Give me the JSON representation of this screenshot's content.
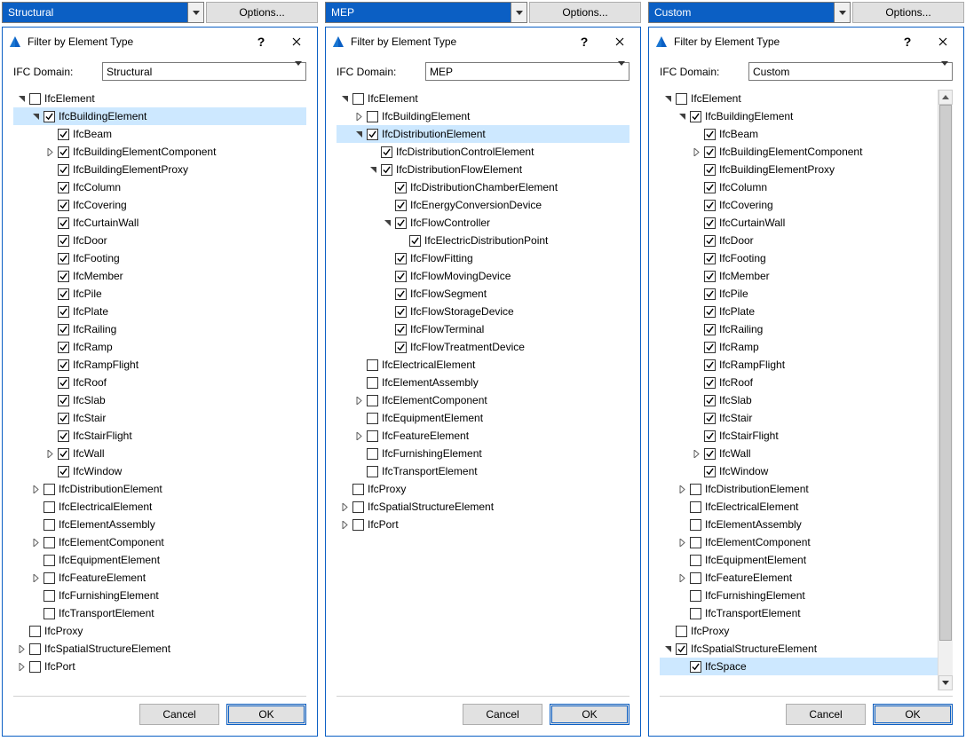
{
  "ribbon_options_label": "Options...",
  "dialog_title": "Filter by Element Type",
  "ifc_domain_label": "IFC Domain:",
  "cancel_label": "Cancel",
  "ok_label": "OK",
  "panels": [
    {
      "ribbon_value": "Structural",
      "domain_select_value": "Structural",
      "has_scrollbar": false,
      "tree": [
        {
          "d": 0,
          "e": "open",
          "c": false,
          "t": "IfcElement"
        },
        {
          "d": 1,
          "e": "open",
          "c": true,
          "t": "IfcBuildingElement",
          "sel": true
        },
        {
          "d": 2,
          "e": null,
          "c": true,
          "t": "IfcBeam"
        },
        {
          "d": 2,
          "e": "closed",
          "c": true,
          "t": "IfcBuildingElementComponent"
        },
        {
          "d": 2,
          "e": null,
          "c": true,
          "t": "IfcBuildingElementProxy"
        },
        {
          "d": 2,
          "e": null,
          "c": true,
          "t": "IfcColumn"
        },
        {
          "d": 2,
          "e": null,
          "c": true,
          "t": "IfcCovering"
        },
        {
          "d": 2,
          "e": null,
          "c": true,
          "t": "IfcCurtainWall"
        },
        {
          "d": 2,
          "e": null,
          "c": true,
          "t": "IfcDoor"
        },
        {
          "d": 2,
          "e": null,
          "c": true,
          "t": "IfcFooting"
        },
        {
          "d": 2,
          "e": null,
          "c": true,
          "t": "IfcMember"
        },
        {
          "d": 2,
          "e": null,
          "c": true,
          "t": "IfcPile"
        },
        {
          "d": 2,
          "e": null,
          "c": true,
          "t": "IfcPlate"
        },
        {
          "d": 2,
          "e": null,
          "c": true,
          "t": "IfcRailing"
        },
        {
          "d": 2,
          "e": null,
          "c": true,
          "t": "IfcRamp"
        },
        {
          "d": 2,
          "e": null,
          "c": true,
          "t": "IfcRampFlight"
        },
        {
          "d": 2,
          "e": null,
          "c": true,
          "t": "IfcRoof"
        },
        {
          "d": 2,
          "e": null,
          "c": true,
          "t": "IfcSlab"
        },
        {
          "d": 2,
          "e": null,
          "c": true,
          "t": "IfcStair"
        },
        {
          "d": 2,
          "e": null,
          "c": true,
          "t": "IfcStairFlight"
        },
        {
          "d": 2,
          "e": "closed",
          "c": true,
          "t": "IfcWall"
        },
        {
          "d": 2,
          "e": null,
          "c": true,
          "t": "IfcWindow"
        },
        {
          "d": 1,
          "e": "closed",
          "c": false,
          "t": "IfcDistributionElement"
        },
        {
          "d": 1,
          "e": null,
          "c": false,
          "t": "IfcElectricalElement"
        },
        {
          "d": 1,
          "e": null,
          "c": false,
          "t": "IfcElementAssembly"
        },
        {
          "d": 1,
          "e": "closed",
          "c": false,
          "t": "IfcElementComponent"
        },
        {
          "d": 1,
          "e": null,
          "c": false,
          "t": "IfcEquipmentElement"
        },
        {
          "d": 1,
          "e": "closed",
          "c": false,
          "t": "IfcFeatureElement"
        },
        {
          "d": 1,
          "e": null,
          "c": false,
          "t": "IfcFurnishingElement"
        },
        {
          "d": 1,
          "e": null,
          "c": false,
          "t": "IfcTransportElement"
        },
        {
          "d": 0,
          "e": null,
          "c": false,
          "t": "IfcProxy"
        },
        {
          "d": 0,
          "e": "closed",
          "c": false,
          "t": "IfcSpatialStructureElement"
        },
        {
          "d": 0,
          "e": "closed",
          "c": false,
          "t": "IfcPort"
        }
      ]
    },
    {
      "ribbon_value": "MEP",
      "domain_select_value": "MEP",
      "has_scrollbar": false,
      "tree": [
        {
          "d": 0,
          "e": "open",
          "c": false,
          "t": "IfcElement"
        },
        {
          "d": 1,
          "e": "closed",
          "c": false,
          "t": "IfcBuildingElement"
        },
        {
          "d": 1,
          "e": "open",
          "c": true,
          "t": "IfcDistributionElement",
          "sel": true
        },
        {
          "d": 2,
          "e": null,
          "c": true,
          "t": "IfcDistributionControlElement"
        },
        {
          "d": 2,
          "e": "open",
          "c": true,
          "t": "IfcDistributionFlowElement"
        },
        {
          "d": 3,
          "e": null,
          "c": true,
          "t": "IfcDistributionChamberElement"
        },
        {
          "d": 3,
          "e": null,
          "c": true,
          "t": "IfcEnergyConversionDevice"
        },
        {
          "d": 3,
          "e": "open",
          "c": true,
          "t": "IfcFlowController"
        },
        {
          "d": 4,
          "e": null,
          "c": true,
          "t": "IfcElectricDistributionPoint"
        },
        {
          "d": 3,
          "e": null,
          "c": true,
          "t": "IfcFlowFitting"
        },
        {
          "d": 3,
          "e": null,
          "c": true,
          "t": "IfcFlowMovingDevice"
        },
        {
          "d": 3,
          "e": null,
          "c": true,
          "t": "IfcFlowSegment"
        },
        {
          "d": 3,
          "e": null,
          "c": true,
          "t": "IfcFlowStorageDevice"
        },
        {
          "d": 3,
          "e": null,
          "c": true,
          "t": "IfcFlowTerminal"
        },
        {
          "d": 3,
          "e": null,
          "c": true,
          "t": "IfcFlowTreatmentDevice"
        },
        {
          "d": 1,
          "e": null,
          "c": false,
          "t": "IfcElectricalElement"
        },
        {
          "d": 1,
          "e": null,
          "c": false,
          "t": "IfcElementAssembly"
        },
        {
          "d": 1,
          "e": "closed",
          "c": false,
          "t": "IfcElementComponent"
        },
        {
          "d": 1,
          "e": null,
          "c": false,
          "t": "IfcEquipmentElement"
        },
        {
          "d": 1,
          "e": "closed",
          "c": false,
          "t": "IfcFeatureElement"
        },
        {
          "d": 1,
          "e": null,
          "c": false,
          "t": "IfcFurnishingElement"
        },
        {
          "d": 1,
          "e": null,
          "c": false,
          "t": "IfcTransportElement"
        },
        {
          "d": 0,
          "e": null,
          "c": false,
          "t": "IfcProxy"
        },
        {
          "d": 0,
          "e": "closed",
          "c": false,
          "t": "IfcSpatialStructureElement"
        },
        {
          "d": 0,
          "e": "closed",
          "c": false,
          "t": "IfcPort"
        }
      ]
    },
    {
      "ribbon_value": "Custom",
      "domain_select_value": "Custom",
      "has_scrollbar": true,
      "scrollbar_thumb": {
        "top": 0,
        "height_pct": 94
      },
      "tree": [
        {
          "d": 0,
          "e": "open",
          "c": false,
          "t": "IfcElement"
        },
        {
          "d": 1,
          "e": "open",
          "c": true,
          "t": "IfcBuildingElement"
        },
        {
          "d": 2,
          "e": null,
          "c": true,
          "t": "IfcBeam"
        },
        {
          "d": 2,
          "e": "closed",
          "c": true,
          "t": "IfcBuildingElementComponent"
        },
        {
          "d": 2,
          "e": null,
          "c": true,
          "t": "IfcBuildingElementProxy"
        },
        {
          "d": 2,
          "e": null,
          "c": true,
          "t": "IfcColumn"
        },
        {
          "d": 2,
          "e": null,
          "c": true,
          "t": "IfcCovering"
        },
        {
          "d": 2,
          "e": null,
          "c": true,
          "t": "IfcCurtainWall"
        },
        {
          "d": 2,
          "e": null,
          "c": true,
          "t": "IfcDoor"
        },
        {
          "d": 2,
          "e": null,
          "c": true,
          "t": "IfcFooting"
        },
        {
          "d": 2,
          "e": null,
          "c": true,
          "t": "IfcMember"
        },
        {
          "d": 2,
          "e": null,
          "c": true,
          "t": "IfcPile"
        },
        {
          "d": 2,
          "e": null,
          "c": true,
          "t": "IfcPlate"
        },
        {
          "d": 2,
          "e": null,
          "c": true,
          "t": "IfcRailing"
        },
        {
          "d": 2,
          "e": null,
          "c": true,
          "t": "IfcRamp"
        },
        {
          "d": 2,
          "e": null,
          "c": true,
          "t": "IfcRampFlight"
        },
        {
          "d": 2,
          "e": null,
          "c": true,
          "t": "IfcRoof"
        },
        {
          "d": 2,
          "e": null,
          "c": true,
          "t": "IfcSlab"
        },
        {
          "d": 2,
          "e": null,
          "c": true,
          "t": "IfcStair"
        },
        {
          "d": 2,
          "e": null,
          "c": true,
          "t": "IfcStairFlight"
        },
        {
          "d": 2,
          "e": "closed",
          "c": true,
          "t": "IfcWall"
        },
        {
          "d": 2,
          "e": null,
          "c": true,
          "t": "IfcWindow"
        },
        {
          "d": 1,
          "e": "closed",
          "c": false,
          "t": "IfcDistributionElement"
        },
        {
          "d": 1,
          "e": null,
          "c": false,
          "t": "IfcElectricalElement"
        },
        {
          "d": 1,
          "e": null,
          "c": false,
          "t": "IfcElementAssembly"
        },
        {
          "d": 1,
          "e": "closed",
          "c": false,
          "t": "IfcElementComponent"
        },
        {
          "d": 1,
          "e": null,
          "c": false,
          "t": "IfcEquipmentElement"
        },
        {
          "d": 1,
          "e": "closed",
          "c": false,
          "t": "IfcFeatureElement"
        },
        {
          "d": 1,
          "e": null,
          "c": false,
          "t": "IfcFurnishingElement"
        },
        {
          "d": 1,
          "e": null,
          "c": false,
          "t": "IfcTransportElement"
        },
        {
          "d": 0,
          "e": null,
          "c": false,
          "t": "IfcProxy"
        },
        {
          "d": 0,
          "e": "open",
          "c": true,
          "t": "IfcSpatialStructureElement"
        },
        {
          "d": 1,
          "e": null,
          "c": true,
          "t": "IfcSpace",
          "sel": true
        }
      ]
    }
  ]
}
